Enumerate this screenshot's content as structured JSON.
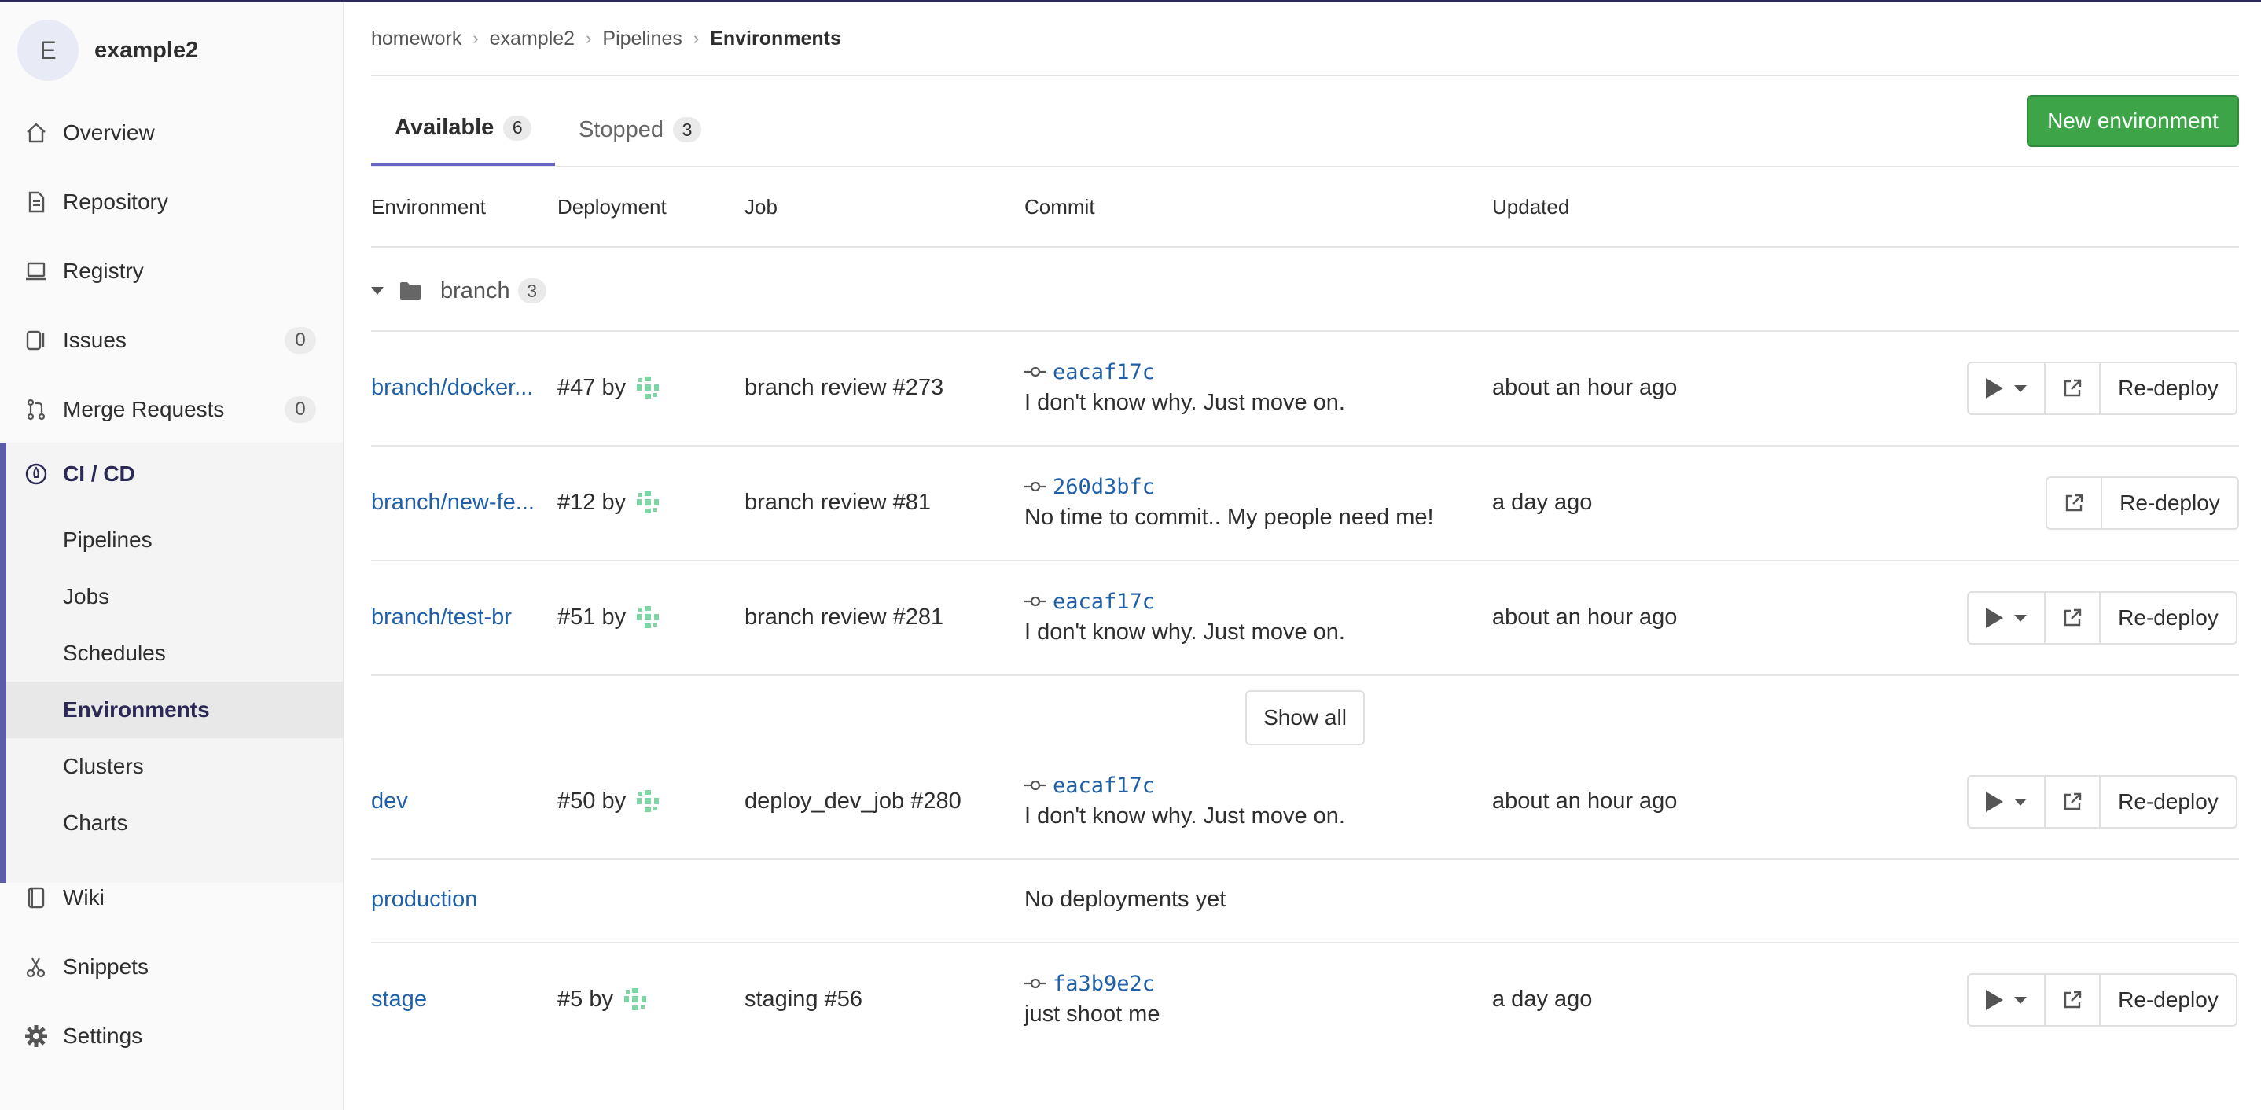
{
  "project": {
    "avatar_letter": "E",
    "name": "example2"
  },
  "sidebar": {
    "items": [
      {
        "label": "Overview",
        "icon": "home-icon"
      },
      {
        "label": "Repository",
        "icon": "doc-icon"
      },
      {
        "label": "Registry",
        "icon": "laptop-icon"
      },
      {
        "label": "Issues",
        "icon": "issues-icon",
        "count": "0"
      },
      {
        "label": "Merge Requests",
        "icon": "merge-icon",
        "count": "0"
      },
      {
        "label": "CI / CD",
        "icon": "rocket-icon"
      },
      {
        "label": "Wiki",
        "icon": "book-icon"
      },
      {
        "label": "Snippets",
        "icon": "scissors-icon"
      },
      {
        "label": "Settings",
        "icon": "gear-icon"
      }
    ],
    "cicd_sub": [
      "Pipelines",
      "Jobs",
      "Schedules",
      "Environments",
      "Clusters",
      "Charts"
    ]
  },
  "breadcrumb": [
    "homework",
    "example2",
    "Pipelines",
    "Environments"
  ],
  "tabs": [
    {
      "label": "Available",
      "count": "6"
    },
    {
      "label": "Stopped",
      "count": "3"
    }
  ],
  "new_env_label": "New environment",
  "columns": [
    "Environment",
    "Deployment",
    "Job",
    "Commit",
    "Updated"
  ],
  "group": {
    "name": "branch",
    "count": "3"
  },
  "rows": [
    {
      "env": "branch/docker...",
      "deployment": "#47 by",
      "job": "branch review #273",
      "sha": "eacaf17c",
      "msg": "I don't know why. Just move on.",
      "updated": "about an hour ago"
    },
    {
      "env": "branch/new-fe...",
      "deployment": "#12 by",
      "job": "branch review #81",
      "sha": "260d3bfc",
      "msg": "No time to commit.. My people need me!",
      "updated": "a day ago"
    },
    {
      "env": "branch/test-br",
      "deployment": "#51 by",
      "job": "branch review #281",
      "sha": "eacaf17c",
      "msg": "I don't know why. Just move on.",
      "updated": "about an hour ago"
    },
    {
      "env": "dev",
      "deployment": "#50 by",
      "job": "deploy_dev_job #280",
      "sha": "eacaf17c",
      "msg": "I don't know why. Just move on.",
      "updated": "about an hour ago"
    },
    {
      "env": "production",
      "no_deploy": "No deployments yet"
    },
    {
      "env": "stage",
      "deployment": "#5 by",
      "job": "staging #56",
      "sha": "fa3b9e2c",
      "msg": "just shoot me",
      "updated": "a day ago"
    }
  ],
  "show_all_label": "Show all",
  "redeploy_label": "Re-deploy",
  "colors": {
    "accent": "#2b2a56",
    "link": "#1f5fa8",
    "green": "#3da548",
    "tab_underline": "#6666c4"
  }
}
